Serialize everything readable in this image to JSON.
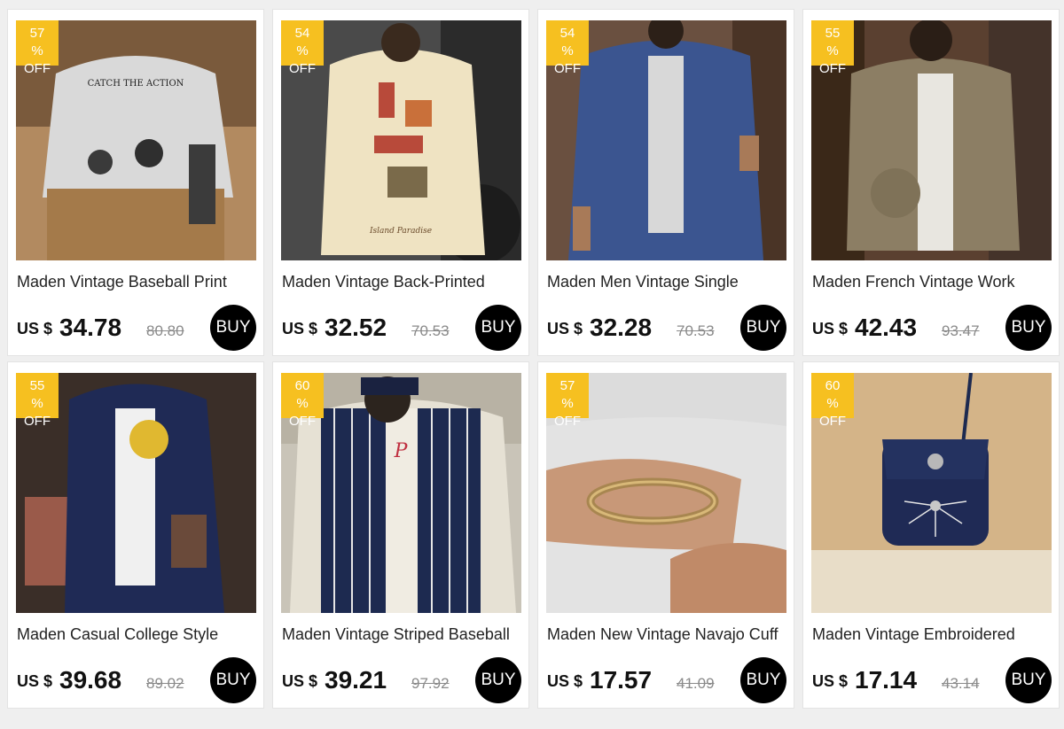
{
  "products": [
    {
      "discount_pct": "57",
      "discount_unit": "%",
      "discount_off": "OFF",
      "title": "Maden Vintage Baseball Print",
      "currency": "US $",
      "price": "34.78",
      "old_price": "80.80",
      "buy_label": "BUY",
      "image": "sweatshirt-baseball-print",
      "image_text": "CATCH THE ACTION"
    },
    {
      "discount_pct": "54",
      "discount_unit": "%",
      "discount_off": "OFF",
      "title": "Maden Vintage Back-Printed",
      "currency": "US $",
      "price": "32.52",
      "old_price": "70.53",
      "buy_label": "BUY",
      "image": "back-printed-shirt",
      "image_text": "Island Paradise"
    },
    {
      "discount_pct": "54",
      "discount_unit": "%",
      "discount_off": "OFF",
      "title": "Maden Men Vintage Single",
      "currency": "US $",
      "price": "32.28",
      "old_price": "70.53",
      "buy_label": "BUY",
      "image": "denim-shirt",
      "image_text": ""
    },
    {
      "discount_pct": "55",
      "discount_unit": "%",
      "discount_off": "OFF",
      "title": "Maden French Vintage Work",
      "currency": "US $",
      "price": "42.43",
      "old_price": "93.47",
      "buy_label": "BUY",
      "image": "work-jacket",
      "image_text": ""
    },
    {
      "discount_pct": "55",
      "discount_unit": "%",
      "discount_off": "OFF",
      "title": "Maden Casual College Style",
      "currency": "US $",
      "price": "39.68",
      "old_price": "89.02",
      "buy_label": "BUY",
      "image": "college-jacket",
      "image_text": ""
    },
    {
      "discount_pct": "60",
      "discount_unit": "%",
      "discount_off": "OFF",
      "title": "Maden Vintage Striped Baseball",
      "currency": "US $",
      "price": "39.21",
      "old_price": "97.92",
      "buy_label": "BUY",
      "image": "striped-baseball-jacket",
      "image_text": ""
    },
    {
      "discount_pct": "57",
      "discount_unit": "%",
      "discount_off": "OFF",
      "title": "Maden New Vintage Navajo Cuff",
      "currency": "US $",
      "price": "17.57",
      "old_price": "41.09",
      "buy_label": "BUY",
      "image": "cuff-bracelet",
      "image_text": ""
    },
    {
      "discount_pct": "60",
      "discount_unit": "%",
      "discount_off": "OFF",
      "title": "Maden Vintage Embroidered",
      "currency": "US $",
      "price": "17.14",
      "old_price": "43.14",
      "buy_label": "BUY",
      "image": "embroidered-bag",
      "image_text": ""
    }
  ],
  "colors": {
    "badge": "#f6c020",
    "buy_button": "#000000",
    "page_bg": "#efefef"
  }
}
